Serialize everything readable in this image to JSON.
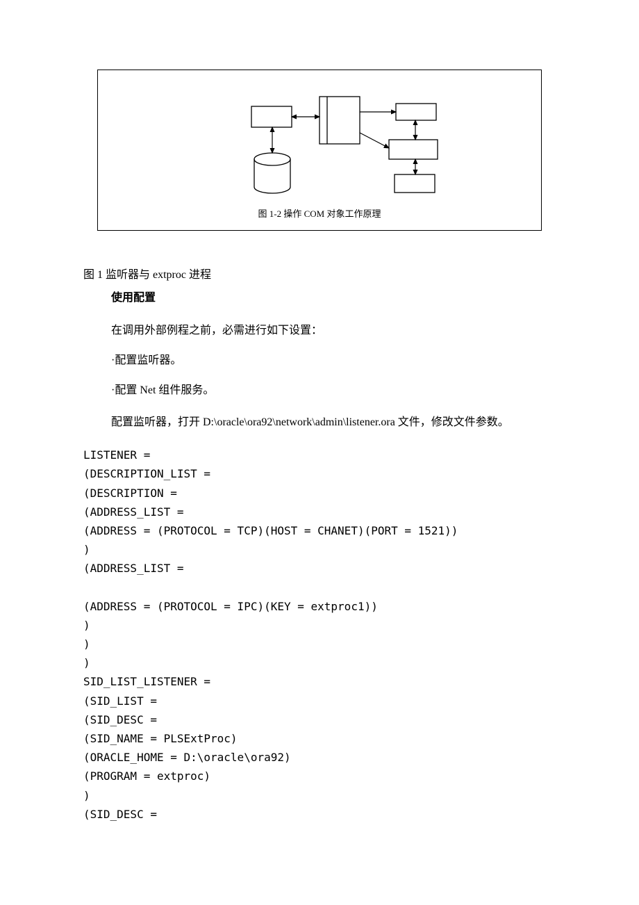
{
  "figure": {
    "inner_caption": "图 1-2 操作 COM 对象工作原理"
  },
  "fig_label": "图 1 监听器与 extproc 进程",
  "section_title": "使用配置",
  "intro_para": "在调用外部例程之前，必需进行如下设置：",
  "bullets": [
    "·配置监听器。",
    "·配置 Net 组件服务。"
  ],
  "config_para": "配置监听器，打开 D:\\oracle\\ora92\\network\\admin\\listener.ora 文件，修改文件参数。",
  "code_lines": [
    "LISTENER =",
    "(DESCRIPTION_LIST =",
    "(DESCRIPTION =",
    "(ADDRESS_LIST =",
    "(ADDRESS = (PROTOCOL = TCP)(HOST = CHANET)(PORT = 1521))",
    ")",
    "(ADDRESS_LIST =",
    "",
    "(ADDRESS = (PROTOCOL = IPC)(KEY = extproc1))",
    ")",
    ")",
    ")",
    "SID_LIST_LISTENER =",
    "(SID_LIST =",
    "(SID_DESC =",
    "(SID_NAME = PLSExtProc)",
    "(ORACLE_HOME = D:\\oracle\\ora92)",
    "(PROGRAM = extproc)",
    ")",
    "(SID_DESC ="
  ],
  "chart_data": {
    "type": "diagram",
    "title": "图 1-2 操作 COM 对象工作原理",
    "nodes": [
      {
        "id": "db",
        "shape": "cylinder"
      },
      {
        "id": "left-box",
        "shape": "rect"
      },
      {
        "id": "center-double",
        "shape": "rect-with-inner"
      },
      {
        "id": "top-right",
        "shape": "rect"
      },
      {
        "id": "mid-right",
        "shape": "rect"
      },
      {
        "id": "bottom-right",
        "shape": "rect"
      }
    ],
    "edges": [
      {
        "from": "db",
        "to": "left-box",
        "bidir": true
      },
      {
        "from": "left-box",
        "to": "center-double",
        "bidir": true
      },
      {
        "from": "center-double",
        "to": "top-right",
        "bidir": false
      },
      {
        "from": "center-double",
        "to": "mid-right",
        "bidir": false
      },
      {
        "from": "top-right",
        "to": "mid-right",
        "bidir": true
      },
      {
        "from": "mid-right",
        "to": "bottom-right",
        "bidir": true
      }
    ]
  }
}
